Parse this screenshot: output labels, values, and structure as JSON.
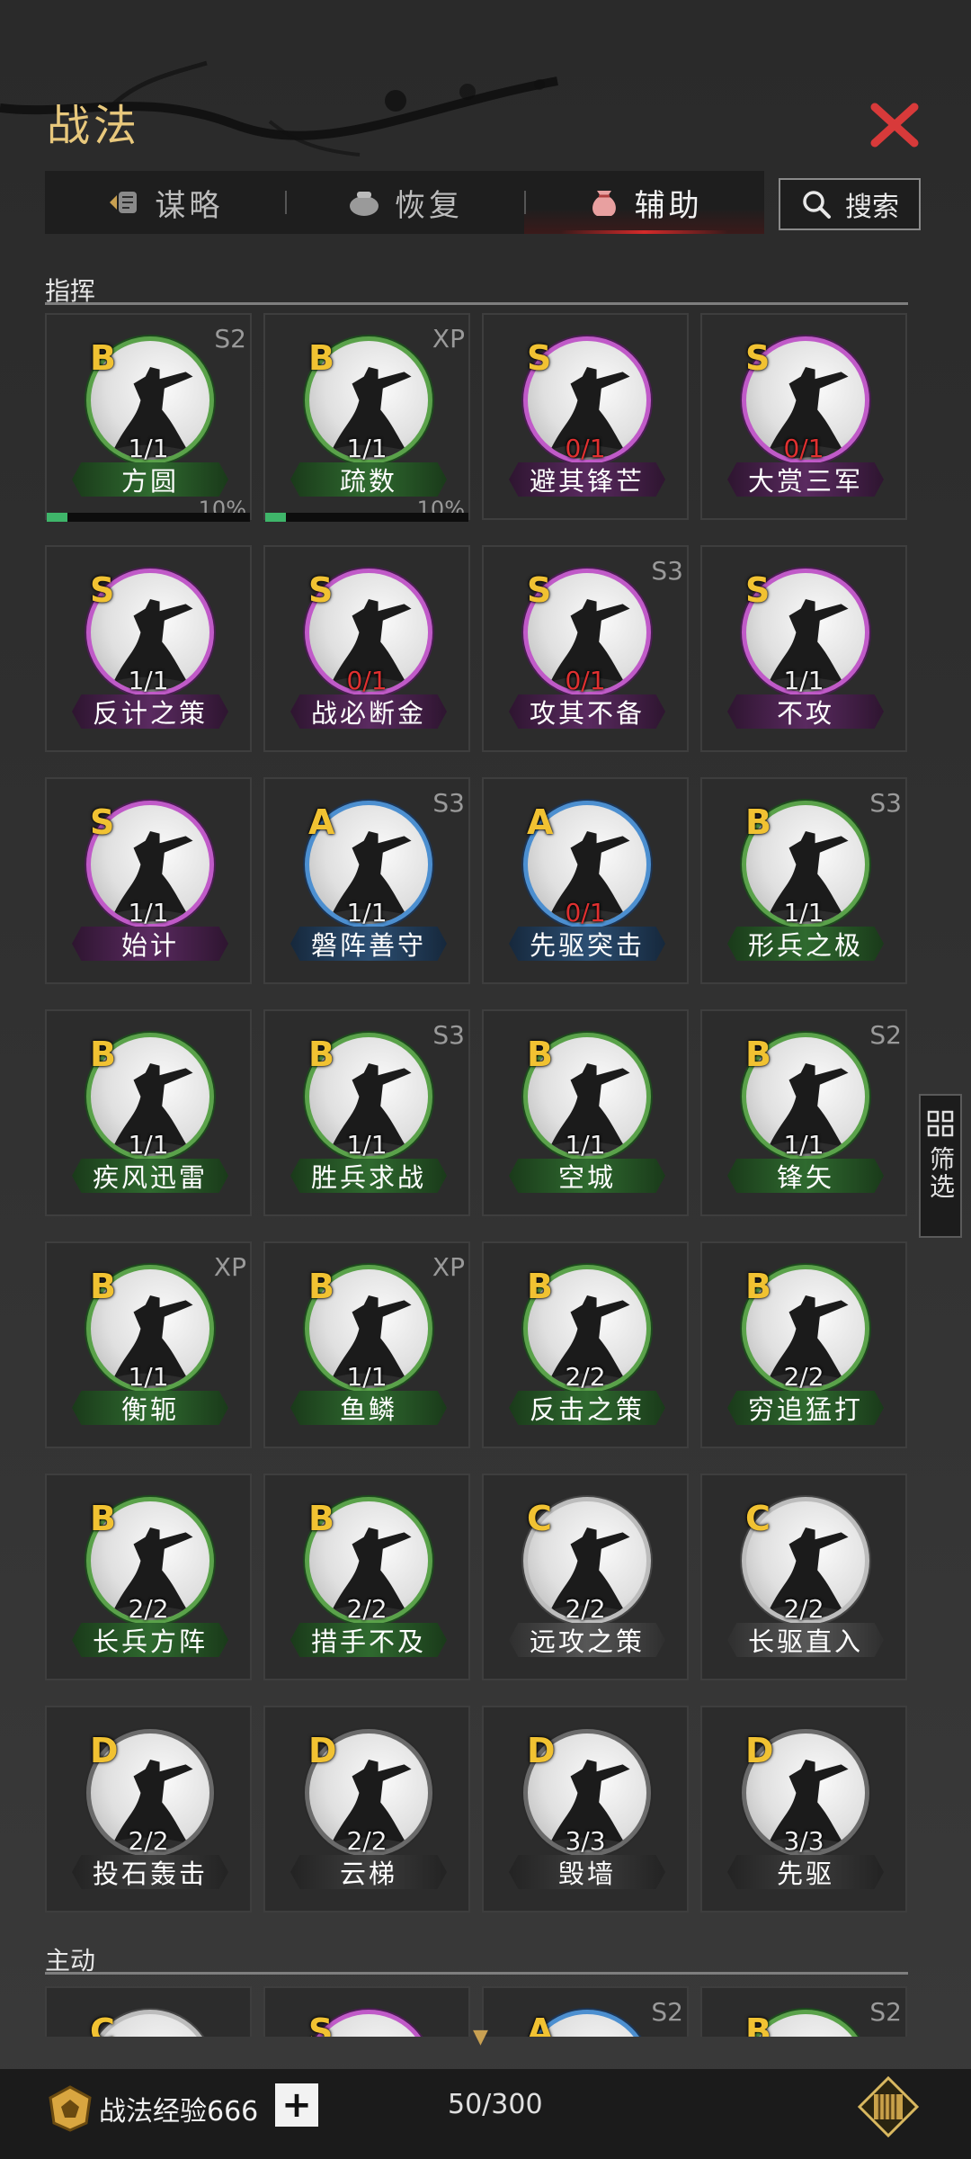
{
  "window": {
    "title": "战法"
  },
  "tabs": [
    {
      "label": "谋略",
      "icon": "scroll-icon",
      "active": false
    },
    {
      "label": "恢复",
      "icon": "pot-icon",
      "active": false
    },
    {
      "label": "辅助",
      "icon": "pouch-icon",
      "active": true
    }
  ],
  "search": {
    "label": "搜索"
  },
  "filter": {
    "label": "筛选"
  },
  "sections": {
    "command": "指挥",
    "active": "主动"
  },
  "cards": [
    {
      "grade": "B",
      "season": "S2",
      "count": "1/1",
      "name": "方圆",
      "percent": "10%",
      "progress": 0.1
    },
    {
      "grade": "B",
      "season": "XP",
      "count": "1/1",
      "name": "疏数",
      "percent": "10%",
      "progress": 0.1
    },
    {
      "grade": "S",
      "season": "",
      "count": "0/1",
      "name": "避其锋芒"
    },
    {
      "grade": "S",
      "season": "",
      "count": "0/1",
      "name": "大赏三军"
    },
    {
      "grade": "S",
      "season": "",
      "count": "1/1",
      "name": "反计之策"
    },
    {
      "grade": "S",
      "season": "",
      "count": "0/1",
      "name": "战必断金"
    },
    {
      "grade": "S",
      "season": "S3",
      "count": "0/1",
      "name": "攻其不备"
    },
    {
      "grade": "S",
      "season": "",
      "count": "1/1",
      "name": "不攻"
    },
    {
      "grade": "S",
      "season": "",
      "count": "1/1",
      "name": "始计"
    },
    {
      "grade": "A",
      "season": "S3",
      "count": "1/1",
      "name": "磐阵善守"
    },
    {
      "grade": "A",
      "season": "",
      "count": "0/1",
      "name": "先驱突击"
    },
    {
      "grade": "B",
      "season": "S3",
      "count": "1/1",
      "name": "形兵之极"
    },
    {
      "grade": "B",
      "season": "",
      "count": "1/1",
      "name": "疾风迅雷"
    },
    {
      "grade": "B",
      "season": "S3",
      "count": "1/1",
      "name": "胜兵求战"
    },
    {
      "grade": "B",
      "season": "",
      "count": "1/1",
      "name": "空城"
    },
    {
      "grade": "B",
      "season": "S2",
      "count": "1/1",
      "name": "锋矢"
    },
    {
      "grade": "B",
      "season": "XP",
      "count": "1/1",
      "name": "衡轭"
    },
    {
      "grade": "B",
      "season": "XP",
      "count": "1/1",
      "name": "鱼鳞"
    },
    {
      "grade": "B",
      "season": "",
      "count": "2/2",
      "name": "反击之策"
    },
    {
      "grade": "B",
      "season": "",
      "count": "2/2",
      "name": "穷追猛打"
    },
    {
      "grade": "B",
      "season": "",
      "count": "2/2",
      "name": "长兵方阵"
    },
    {
      "grade": "B",
      "season": "",
      "count": "2/2",
      "name": "措手不及"
    },
    {
      "grade": "C",
      "season": "",
      "count": "2/2",
      "name": "远攻之策"
    },
    {
      "grade": "C",
      "season": "",
      "count": "2/2",
      "name": "长驱直入"
    },
    {
      "grade": "D",
      "season": "",
      "count": "2/2",
      "name": "投石轰击"
    },
    {
      "grade": "D",
      "season": "",
      "count": "2/2",
      "name": "云梯"
    },
    {
      "grade": "D",
      "season": "",
      "count": "3/3",
      "name": "毁墙"
    },
    {
      "grade": "D",
      "season": "",
      "count": "3/3",
      "name": "先驱"
    }
  ],
  "partial_cards": [
    {
      "grade": "C",
      "season": ""
    },
    {
      "grade": "S",
      "season": ""
    },
    {
      "grade": "A",
      "season": "S2"
    },
    {
      "grade": "B",
      "season": "S2"
    }
  ],
  "bottom": {
    "exp_label": "战法经验666",
    "plus": "+",
    "capacity": "50/300"
  },
  "colors": {
    "title": "#e8c87c",
    "close": "#d83a3a",
    "grade": "#f1c232",
    "count_zero": "#e03030",
    "progress": "#3fb56a"
  }
}
